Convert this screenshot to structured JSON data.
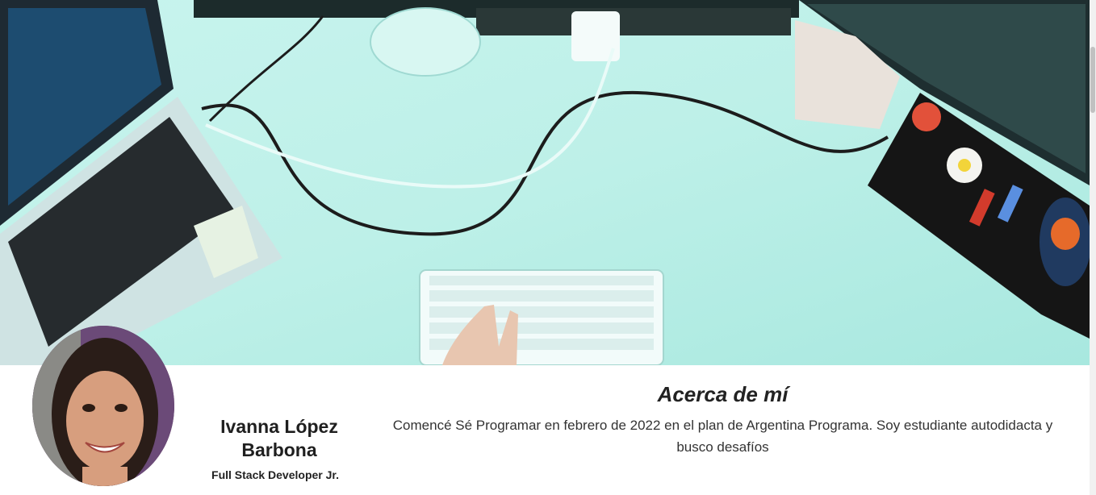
{
  "profile": {
    "name": "Ivanna López Barbona",
    "role": "Full Stack Developer Jr."
  },
  "about": {
    "title": "Acerca de mí",
    "text": "Comencé Sé Programar en febrero de 2022 en el plan de Argentina Programa. Soy estudiante autodidacta y busco desafíos"
  },
  "colors": {
    "banner_tint": "#bff0ea",
    "text_dark": "#222222"
  }
}
